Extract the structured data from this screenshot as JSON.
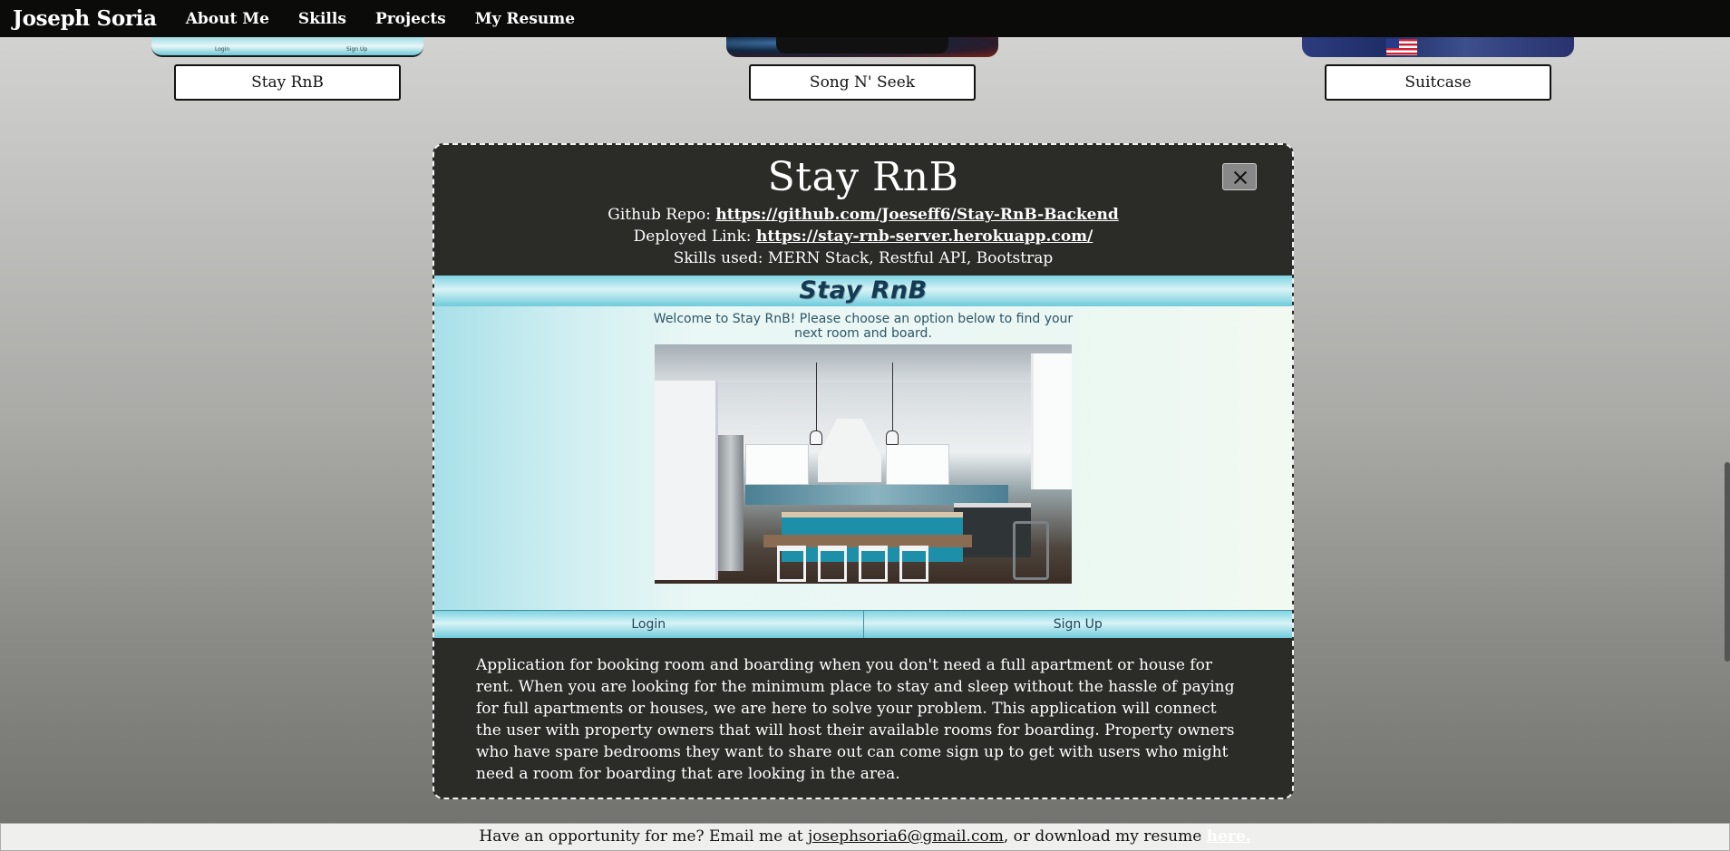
{
  "nav": {
    "brand": "Joseph Soria",
    "links": [
      "About Me",
      "Skills",
      "Projects",
      "My Resume"
    ]
  },
  "cards": [
    {
      "label": "Stay RnB",
      "thumb_left": "Login",
      "thumb_right": "Sign Up"
    },
    {
      "label": "Song N' Seek"
    },
    {
      "label": "Suitcase"
    }
  ],
  "modal": {
    "title": "Stay RnB",
    "github_label": "Github Repo:",
    "github_link": "https://github.com/Joeseff6/Stay-RnB-Backend",
    "deployed_label": "Deployed Link:",
    "deployed_link": "https://stay-rnb-server.herokuapp.com/",
    "skills": "Skills used: MERN Stack, Restful API, Bootstrap",
    "preview": {
      "logo": "Stay RnB",
      "welcome": "Welcome to Stay RnB! Please choose an option below to find your next room and board.",
      "login": "Login",
      "signup": "Sign Up"
    },
    "description": "Application for booking room and boarding when you don't need a full apartment or house for rent. When you are looking for the minimum place to stay and sleep without the hassle of paying for full apartments or houses, we are here to solve your problem. This application will connect the user with property owners that will host their available rooms for boarding. Property owners who have spare bedrooms they want to share out can come sign up to get with users who might need a room for boarding that are looking in the area."
  },
  "footer": {
    "prefix": "Have an opportunity for me? Email me at ",
    "email": "josephsoria6@gmail.com",
    "middle": ", or download my resume ",
    "here": "here."
  }
}
